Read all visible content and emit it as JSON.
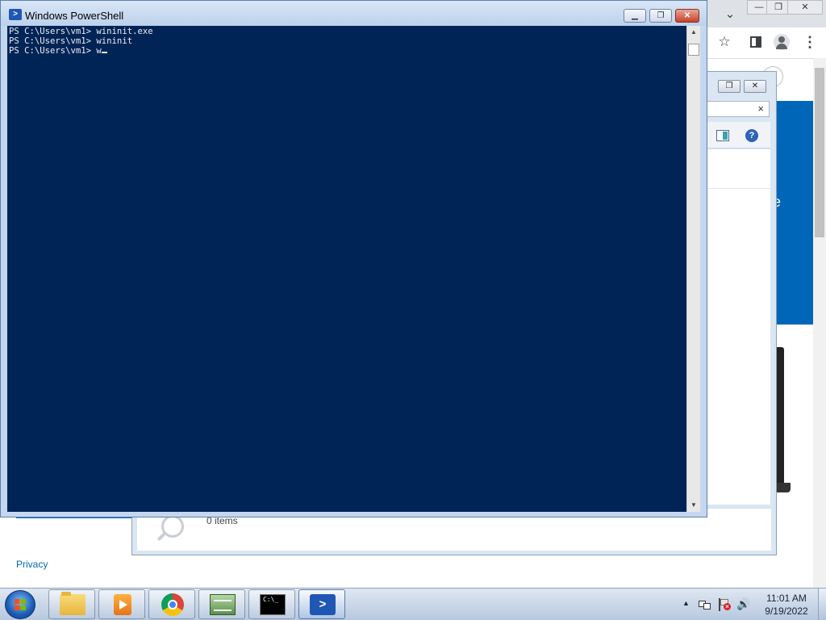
{
  "powershell": {
    "title": "Windows PowerShell",
    "console_lines": [
      "PS C:\\Users\\vm1> wininit.exe",
      "PS C:\\Users\\vm1> wininit",
      "PS C:\\Users\\vm1> w"
    ],
    "minimize_label": "▁",
    "restore_label": "❐",
    "close_label": "✕",
    "background_color": "#012456",
    "text_color": "#eeedf0"
  },
  "background_browser": {
    "footer_link": "Privacy",
    "partial_text": "e",
    "chevron_label": "⌄",
    "star_label": "☆",
    "ctl_minimize": "—",
    "ctl_restore": "❐",
    "ctl_close": "✕"
  },
  "background_dialog": {
    "status_items": "0 items",
    "search_clear": "×",
    "help_label": "?",
    "restore_label": "❐",
    "close_label": "✕"
  },
  "taskbar": {
    "clock_time": "11:01 AM",
    "clock_date": "9/19/2022",
    "tray_expand_label": "▲",
    "cmd_label": "C:\\_"
  }
}
